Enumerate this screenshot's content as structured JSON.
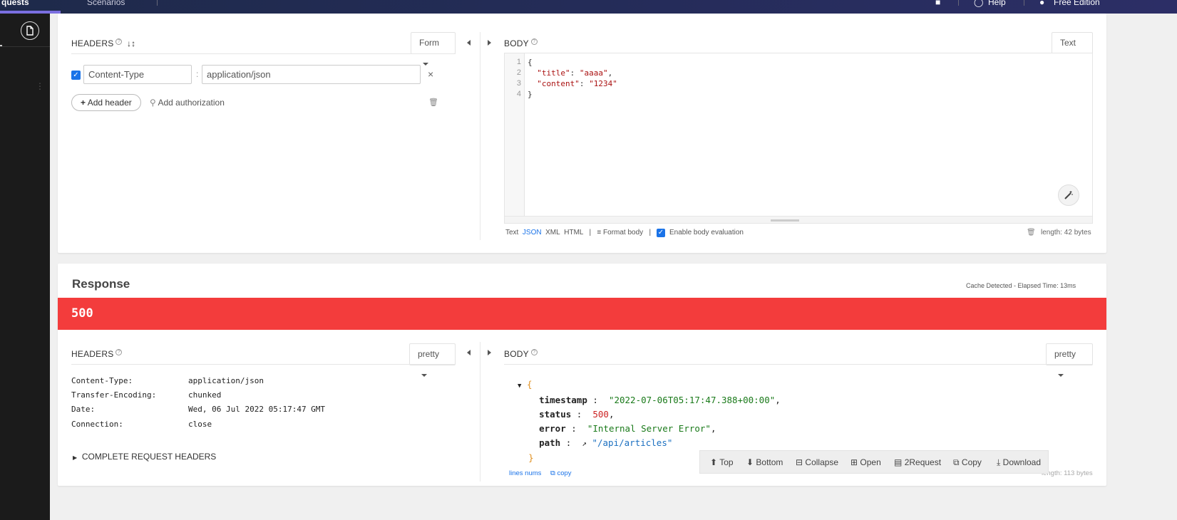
{
  "topbar": {
    "tab_requests": "quests",
    "tab_scenarios": "Scenarios",
    "help": "Help",
    "edition": "Free Edition"
  },
  "request": {
    "headers": {
      "title": "HEADERS",
      "mode": "Form",
      "rows": [
        {
          "enabled": true,
          "name": "Content-Type",
          "value": "application/json"
        }
      ],
      "add_header": "Add header",
      "add_authorization": "Add authorization"
    },
    "body": {
      "title": "BODY",
      "mode": "Text",
      "lines": [
        "1",
        "2",
        "3",
        "4"
      ],
      "code": {
        "open": "{",
        "title_key": "\"title\"",
        "title_val": "\"aaaa\"",
        "content_key": "\"content\"",
        "content_val": "\"1234\"",
        "close": "}"
      },
      "formats": {
        "text": "Text",
        "json": "JSON",
        "xml": "XML",
        "html": "HTML"
      },
      "format_body": "Format body",
      "enable_eval": "Enable body evaluation",
      "length": "length: 42 bytes"
    }
  },
  "response": {
    "title": "Response",
    "meta": "Cache Detected - Elapsed Time: 13ms",
    "status_code": "500",
    "status_color": "#f33c3c",
    "headers": {
      "title": "HEADERS",
      "mode": "pretty",
      "rows": [
        {
          "name": "Content-Type:",
          "value": "application/json"
        },
        {
          "name": "Transfer-Encoding:",
          "value": "chunked"
        },
        {
          "name": "Date:",
          "value": "Wed, 06 Jul 2022 05:17:47 GMT"
        },
        {
          "name": "Connection:",
          "value": "close"
        }
      ],
      "complete": "COMPLETE REQUEST HEADERS"
    },
    "body": {
      "title": "BODY",
      "mode": "pretty",
      "open": "{",
      "close": "}",
      "timestamp_key": "timestamp",
      "timestamp_val": "\"2022-07-06T05:17:47.388+00:00\"",
      "status_key": "status",
      "status_val": "500",
      "error_key": "error",
      "error_val": "\"Internal Server Error\"",
      "path_key": "path",
      "path_val": "\"/api/articles\"",
      "lines_nums": "lines nums",
      "copy": "copy",
      "length_hint": "length: 113 bytes"
    },
    "toolbar": {
      "top": "Top",
      "bottom": "Bottom",
      "collapse": "Collapse",
      "open": "Open",
      "to_request": "2Request",
      "copy": "Copy",
      "download": "Download"
    }
  }
}
